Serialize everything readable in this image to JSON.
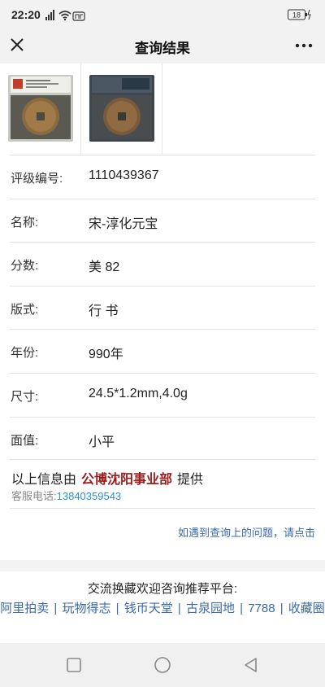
{
  "status": {
    "time": "22:20",
    "battery": "18"
  },
  "titlebar": {
    "title": "查询结果"
  },
  "rows": [
    {
      "label": "评级编号:",
      "value": "1110439367"
    },
    {
      "label": "名称:",
      "value": "宋-淳化元宝"
    },
    {
      "label": "分数:",
      "value": "美 82"
    },
    {
      "label": "版式:",
      "value": "行 书"
    },
    {
      "label": "年份:",
      "value": "990年"
    },
    {
      "label": "尺寸:",
      "value": "24.5*1.2mm,4.0g"
    },
    {
      "label": "面值:",
      "value": "小平"
    }
  ],
  "provider": {
    "prefix": "以上信息由",
    "org": "公博沈阳事业部",
    "suffix": "提供",
    "phone_label": "客服电话:",
    "phone": "13840359543"
  },
  "ask_link": "如遇到查询上的问题，请点击",
  "footer": {
    "heading": "交流换藏欢迎咨询推荐平台:",
    "links": [
      "阿里拍卖",
      "玩物得志",
      "钱币天堂",
      "古泉园地",
      "7788",
      "收藏圈"
    ]
  },
  "icons": {
    "close": "close-icon",
    "more": "more-icon",
    "signal": "signal-icon",
    "wifi": "wifi-icon",
    "battery": "battery-icon",
    "nav_recent": "square-icon",
    "nav_home": "circle-icon",
    "nav_back": "triangle-back-icon"
  },
  "colors": {
    "org": "#9b1b1b",
    "link": "#3b6aa8",
    "phone": "#2a8fd8"
  }
}
